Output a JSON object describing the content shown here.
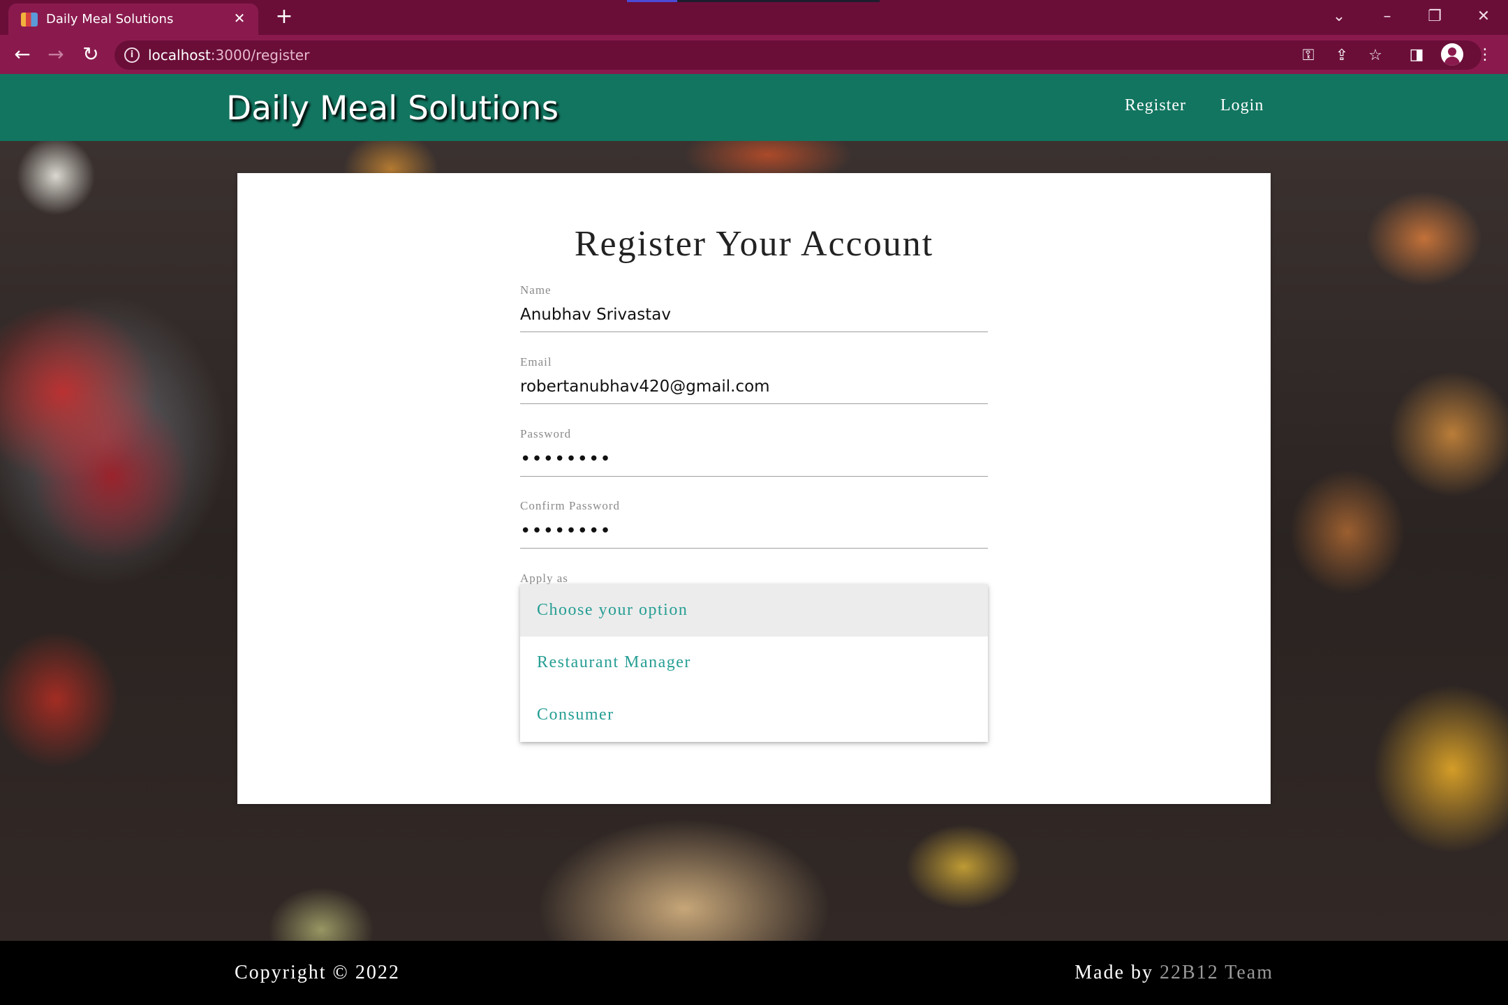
{
  "browser": {
    "tab_title": "Daily Meal Solutions",
    "url_host": "localhost",
    "url_path": ":3000/register",
    "icons": {
      "tab_close": "close-icon",
      "new_tab": "plus-icon",
      "back": "arrow-left-icon",
      "forward": "arrow-right-icon",
      "reload": "reload-icon",
      "site_info": "info-icon",
      "password": "key-icon",
      "share": "share-icon",
      "bookmark": "star-icon",
      "side_panel": "side-panel-icon",
      "profile": "profile-icon",
      "menu": "kebab-menu-icon"
    }
  },
  "navbar": {
    "brand": "Daily Meal Solutions",
    "links": [
      "Register",
      "Login"
    ]
  },
  "form": {
    "title": "Register Your Account",
    "fields": [
      {
        "label": "Name",
        "value": "Anubhav Srivastav"
      },
      {
        "label": "Email",
        "value": "robertanubhav420@gmail.com"
      },
      {
        "label": "Password",
        "value": "••••••••"
      },
      {
        "label": "Confirm Password",
        "value": "••••••••"
      }
    ],
    "apply_as": {
      "label": "Apply as",
      "options": [
        "Choose your option",
        "Restaurant Manager",
        "Consumer"
      ],
      "highlighted_index": 0
    }
  },
  "footer": {
    "copyright": "Copyright © 2022",
    "made_by_prefix": "Made by ",
    "made_by_team": "22B12 Team"
  },
  "colors": {
    "tabbar": "#6a0e38",
    "toolbar": "#8a1a4d",
    "navbar": "#127560",
    "dropdown_text": "#269e94",
    "footer": "#000000"
  }
}
